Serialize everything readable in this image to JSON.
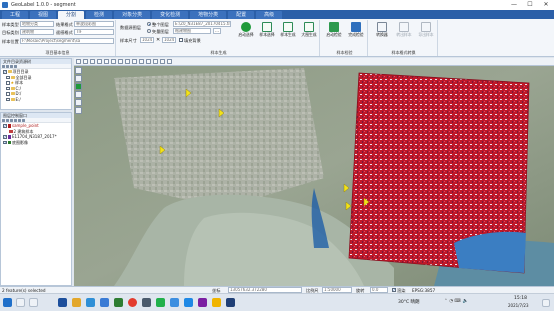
{
  "window": {
    "title": "GeoLabel 1.0.0 - segment",
    "minimize": "—",
    "maximize": "☐",
    "close": "✕"
  },
  "tabs": [
    {
      "label": "工程",
      "active": false
    },
    {
      "label": "视图",
      "active": false
    },
    {
      "label": "分割",
      "active": true
    },
    {
      "label": "检测",
      "active": false
    },
    {
      "label": "对象分类",
      "active": false
    },
    {
      "label": "变化检测",
      "active": false
    },
    {
      "label": "地物分类",
      "active": false
    },
    {
      "label": "配置",
      "active": false
    },
    {
      "label": "高级",
      "active": false
    }
  ],
  "ribbon": {
    "settings": {
      "sample_type_label": "样本类型",
      "sample_type_value": "地物分类",
      "output_format_label": "结果格式",
      "output_format_value": "单波段彩图",
      "target_category_label": "目标类别",
      "target_category_value": "建筑物",
      "output_format2_label": "遥感格式",
      "output_format2_value": "TIF",
      "sample_location_label": "样本位置",
      "sample_location_value": "F:\\Mosaic\\Project\\segment\\sa",
      "caption": "项目基本信息"
    },
    "generate": {
      "data_source_label": "数据源图层",
      "data_source_value": "E:\\Z0_N31E87_20170415.tif",
      "full_layer_label": "整个图层",
      "vector_layer_label": "矢量图层",
      "vector_layer_value": "格建物图",
      "sample_size_label": "样本尺寸",
      "sample_size_w": "1024",
      "sample_size_h": "1024",
      "sample_fill_label": "填充背景",
      "run_label": "启动选择",
      "sample_select_label": "样本选择",
      "sample_generate_label": "样本生成",
      "sample_clip_label": "大图生成",
      "caption": "样本生成"
    },
    "check": {
      "label": "启动检验",
      "complete_label": "完成检验",
      "caption": "样本检验"
    },
    "convert": {
      "transform_label": "转换器",
      "btn2_label": "转出样本",
      "btn3_label": "导出样本",
      "caption": "样本格式转换"
    }
  },
  "layer_panel": {
    "title": "文件目录资源树",
    "items": [
      {
        "label": "项目目录",
        "kind": "folder",
        "checked": true
      },
      {
        "label": "全部目录",
        "kind": "folder",
        "checked": false
      },
      {
        "label": "样本",
        "kind": "star",
        "checked": false
      },
      {
        "label": "C:/",
        "kind": "folder",
        "checked": false
      },
      {
        "label": "D:/",
        "kind": "folder",
        "checked": false
      },
      {
        "label": "E:/",
        "kind": "folder",
        "checked": false
      }
    ]
  },
  "map_panel": {
    "title": "图层控制窗口",
    "items": [
      {
        "label": "sample_point",
        "kind": "vector",
        "checked": true,
        "color": "#b02020"
      },
      {
        "label": "2 建筑样本",
        "kind": "sub",
        "checked": false,
        "color": "#c04040"
      },
      {
        "label": "E11704_N3187_2017*",
        "kind": "raster",
        "checked": true,
        "color": "#6a2d9a"
      },
      {
        "label": "底图影像",
        "kind": "raster",
        "checked": true,
        "color": "#2b7a2b"
      }
    ]
  },
  "map": {
    "point_color": "#f2e21a",
    "image_color": "#c01828",
    "water_color": "#9fb0a0"
  },
  "status": {
    "left": "2 feature(s) selected",
    "scale_label": "比例尺",
    "scale_value": "1:50000",
    "coords_label": "坐标",
    "coords_value": "13057632.372280",
    "rotate_label": "旋转",
    "rotate_value": "0.0",
    "render_label": "渲染",
    "epsg": "EPSG:3857"
  },
  "taskbar": {
    "weather": "30°C 晴朗",
    "time": "15:18",
    "date": "2021/7/23"
  }
}
